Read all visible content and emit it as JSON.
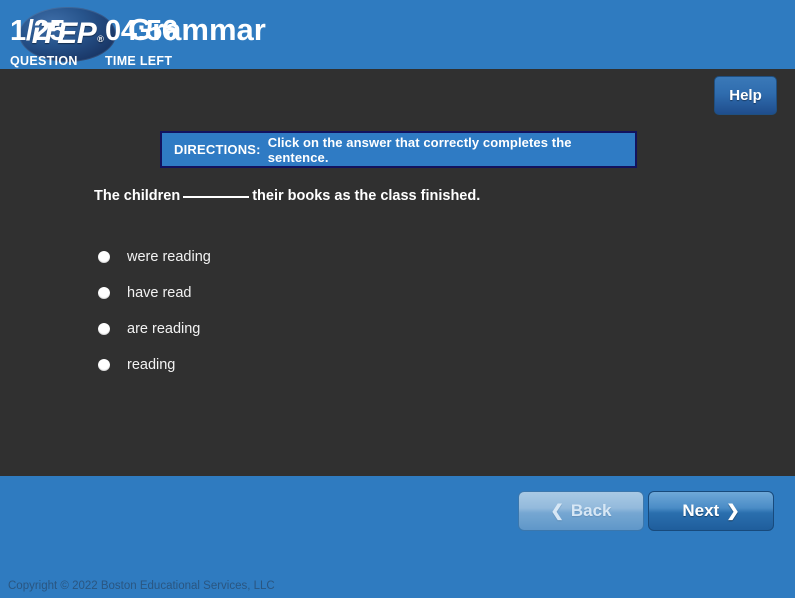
{
  "header": {
    "logo_text": "iTEP",
    "logo_trademark": "®",
    "title": "Grammar",
    "background_color": "#2f7bc0"
  },
  "content": {
    "help_label": "Help",
    "directions": {
      "label": "DIRECTIONS:",
      "text": "Click on the answer that correctly completes the sentence.",
      "fill_color": "#2f7bc4",
      "border_color": "#12125e"
    },
    "question": {
      "before_blank": "The children",
      "blank": "________",
      "after_blank": "their books as the class finished."
    },
    "options": [
      {
        "label": "were reading",
        "selected": false
      },
      {
        "label": "have read",
        "selected": false
      },
      {
        "label": "are reading",
        "selected": false
      },
      {
        "label": "reading",
        "selected": false
      }
    ]
  },
  "footer": {
    "question_value": "1/25",
    "question_caption": "QUESTION",
    "time_value": "04:56",
    "time_caption": "TIME LEFT",
    "back_label": "Back",
    "back_chevron": "❮",
    "back_disabled": true,
    "next_label": "Next",
    "next_chevron": "❯",
    "copyright": "Copyright © 2022 Boston Educational Services, LLC"
  }
}
